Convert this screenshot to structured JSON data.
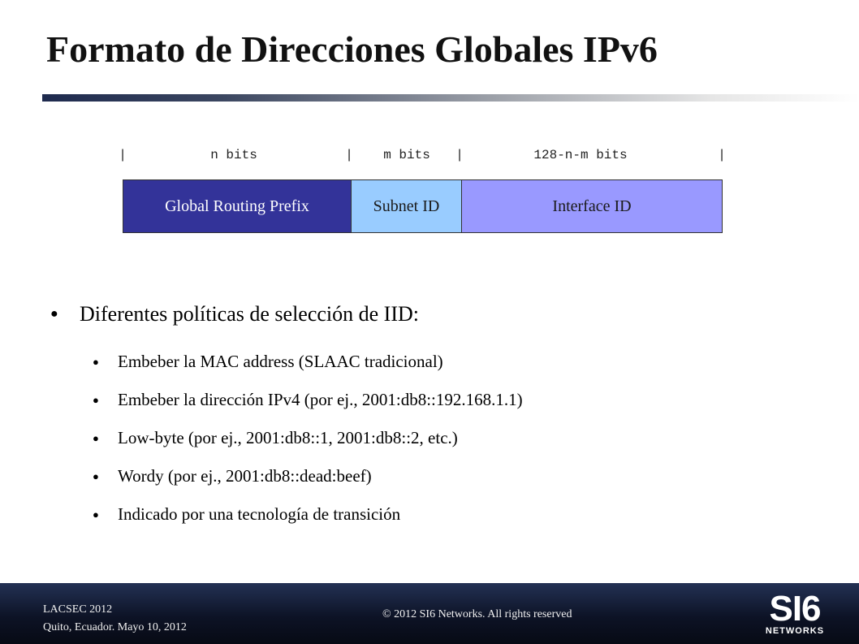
{
  "slide": {
    "title": "Formato de Direcciones Globales IPv6",
    "bits_header": {
      "separator": "|",
      "labels": [
        "n bits",
        "m bits",
        "128-n-m bits"
      ]
    },
    "address_fields": [
      "Global Routing Prefix",
      "Subnet ID",
      "Interface ID"
    ],
    "bullets": {
      "marker": "●",
      "main": "Diferentes políticas de selección de IID:",
      "sub": [
        "Embeber la MAC address (SLAAC tradicional)",
        "Embeber la dirección IPv4 (por ej., 2001:db8::192.168.1.1)",
        "Low-byte (por ej., 2001:db8::1, 2001:db8::2, etc.)",
        "Wordy (por ej., 2001:db8::dead:beef)",
        "Indicado por una tecnología de transición"
      ]
    }
  },
  "footer": {
    "event": "LACSEC 2012",
    "location_date": "Quito, Ecuador. Mayo 10, 2012",
    "copyright": "© 2012 SI6 Networks. All rights reserved",
    "logo_main": "SI6",
    "logo_sub": "NETWORKS"
  },
  "colors": {
    "global_routing_prefix": "#333399",
    "subnet_id": "#99ccff",
    "interface_id": "#9999ff",
    "footer": "#0d1326"
  }
}
